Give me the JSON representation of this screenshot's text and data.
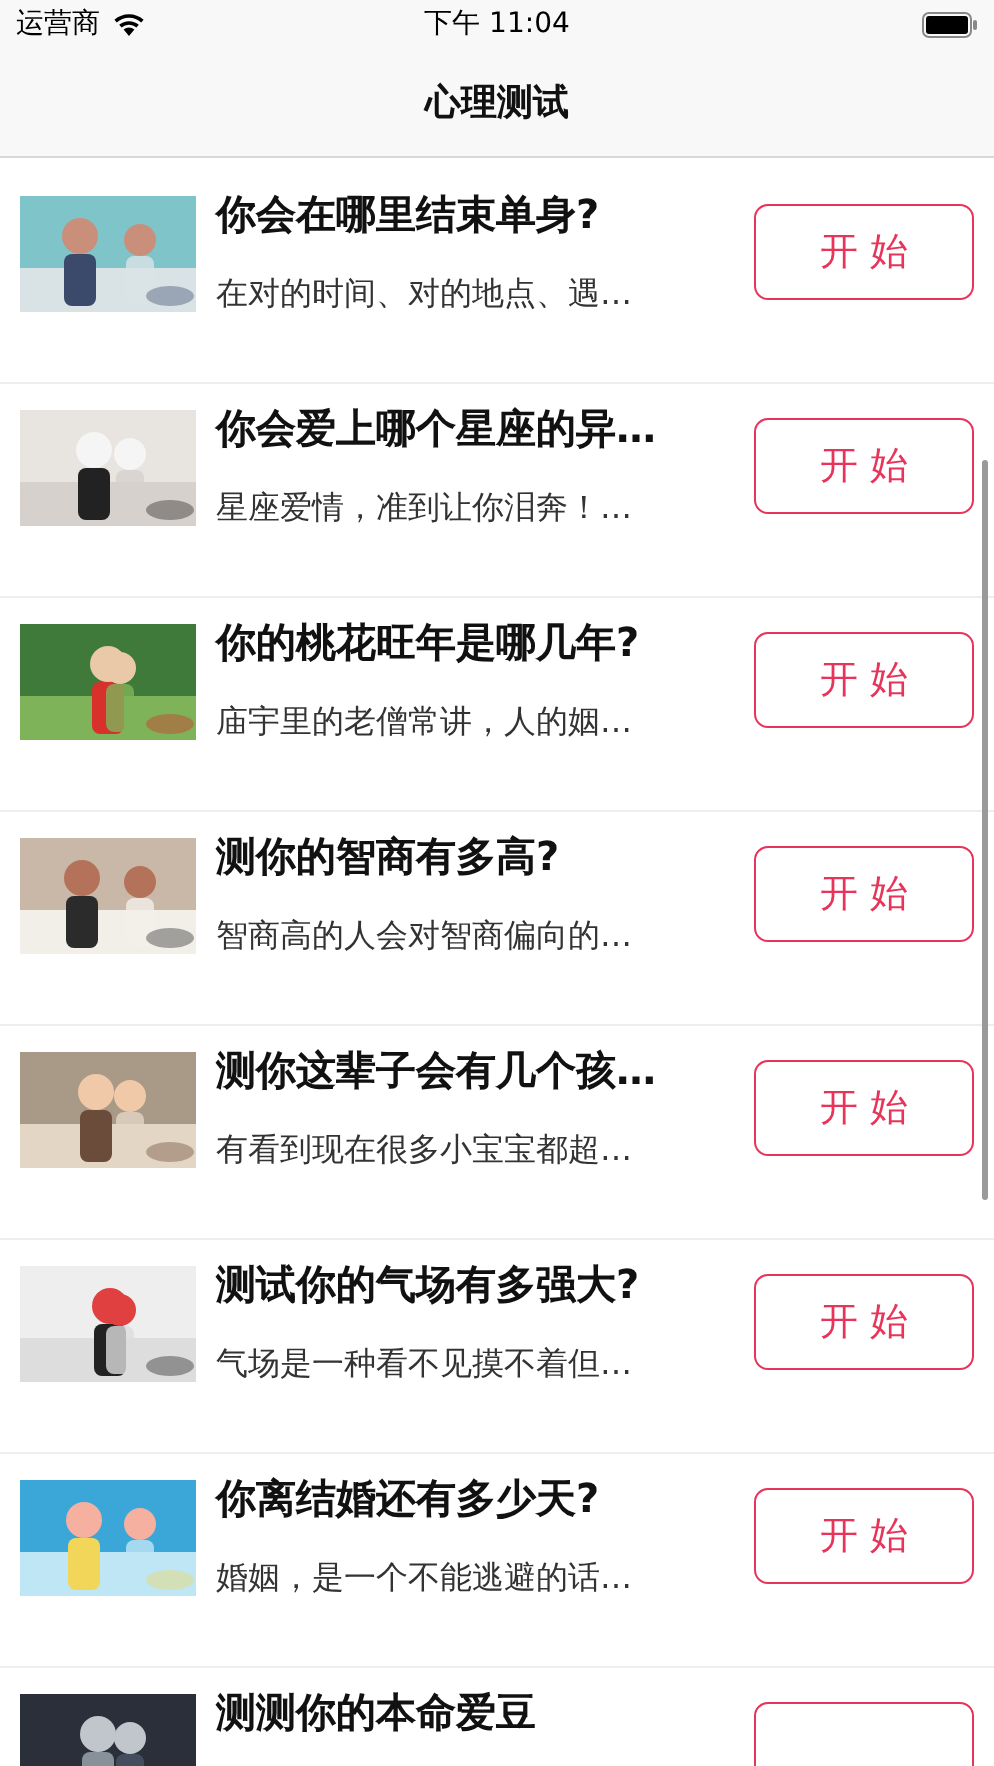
{
  "status_bar": {
    "carrier": "运营商",
    "time": "下午 11:04"
  },
  "nav": {
    "title": "心理测试"
  },
  "tests": [
    {
      "title": "你会在哪里结束单身?",
      "subtitle": "在对的时间、对的地点、遇…",
      "button": "开 始"
    },
    {
      "title": "你会爱上哪个星座的异…",
      "subtitle": "星座爱情，准到让你泪奔！…",
      "button": "开 始"
    },
    {
      "title": "你的桃花旺年是哪几年?",
      "subtitle": "庙宇里的老僧常讲，人的姻…",
      "button": "开 始"
    },
    {
      "title": "测你的智商有多高?",
      "subtitle": "智商高的人会对智商偏向的…",
      "button": "开 始"
    },
    {
      "title": "测你这辈子会有几个孩…",
      "subtitle": "有看到现在很多小宝宝都超…",
      "button": "开 始"
    },
    {
      "title": "测试你的气场有多强大?",
      "subtitle": "气场是一种看不见摸不着但…",
      "button": "开 始"
    },
    {
      "title": "你离结婚还有多少天?",
      "subtitle": "婚姻，是一个不能逃避的话…",
      "button": "开 始"
    },
    {
      "title": "测测你的本命爱豆"
    }
  ]
}
